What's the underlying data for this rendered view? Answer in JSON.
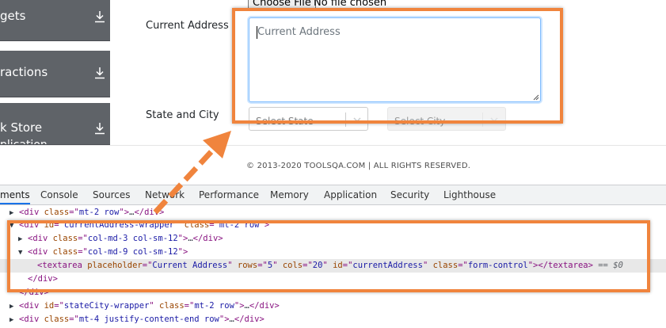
{
  "sidebar": {
    "items": [
      {
        "label": "gets",
        "sub": ""
      },
      {
        "label": "ractions",
        "sub": ""
      },
      {
        "label": "k Store",
        "sub": "plication"
      }
    ]
  },
  "form": {
    "choose_file_label": "Choose File",
    "no_file_text": "No file chosen",
    "current_address_label": "Current Address",
    "current_address_placeholder": "Current Address",
    "state_city_label": "State and City",
    "select_state_placeholder": "Select State",
    "select_city_placeholder": "Select City"
  },
  "footer": {
    "copyright": "© 2013-2020 TOOLSQA.COM | ALL RIGHTS RESERVED."
  },
  "devtools": {
    "tabs": [
      "ments",
      "Console",
      "Sources",
      "Network",
      "Performance",
      "Memory",
      "Application",
      "Security",
      "Lighthouse"
    ],
    "active_tab": "ments",
    "lines": [
      {
        "toggle": "▶",
        "parts": [
          "<div ",
          "class",
          "=\"",
          "mt-2 row",
          "\">",
          "…",
          "</div>"
        ]
      },
      {
        "toggle": "▼",
        "parts": [
          "<div ",
          "id",
          "=\"",
          "currentAddress-wrapper",
          "\" ",
          "class",
          "=\"",
          "mt-2 row",
          "\">"
        ]
      },
      {
        "toggle": "▶",
        "parts": [
          "<div ",
          "class",
          "=\"",
          "col-md-3 col-sm-12",
          "\">",
          "…",
          "</div>"
        ]
      },
      {
        "toggle": "▼",
        "parts": [
          "<div ",
          "class",
          "=\"",
          "col-md-9 col-sm-12",
          "\">"
        ]
      },
      {
        "toggle": "",
        "textarea": {
          "open": "<textarea ",
          "a1": "placeholder",
          "v1": "Current Address",
          "a2": "rows",
          "v2": "5",
          "a3": "cols",
          "v3": "20",
          "a4": "id",
          "v4": "currentAddress",
          "a5": "class",
          "v5": "form-control",
          "close": "></textarea>",
          "eq": "== $0"
        }
      },
      {
        "toggle": "",
        "parts": [
          "</div>"
        ]
      },
      {
        "toggle": "",
        "parts": [
          "</div>"
        ]
      },
      {
        "toggle": "▶",
        "parts": [
          "<div ",
          "id",
          "=\"",
          "stateCity-wrapper",
          "\" ",
          "class",
          "=\"",
          "mt-2 row",
          "\">",
          "…",
          "</div>"
        ]
      },
      {
        "toggle": "▶",
        "parts": [
          "<div ",
          "class",
          "=\"",
          "mt-4 justify-content-end row",
          "\">",
          "…",
          "</div>"
        ]
      }
    ]
  },
  "colors": {
    "annotation": "#f0843d",
    "sidebar_bg": "#5f6368",
    "focus_border": "#80bdff"
  },
  "icons": [
    "download-icon",
    "chevron-down-icon",
    "resize-handle-icon",
    "expand-triangle-icon",
    "collapse-triangle-icon",
    "arrow-annotation"
  ]
}
